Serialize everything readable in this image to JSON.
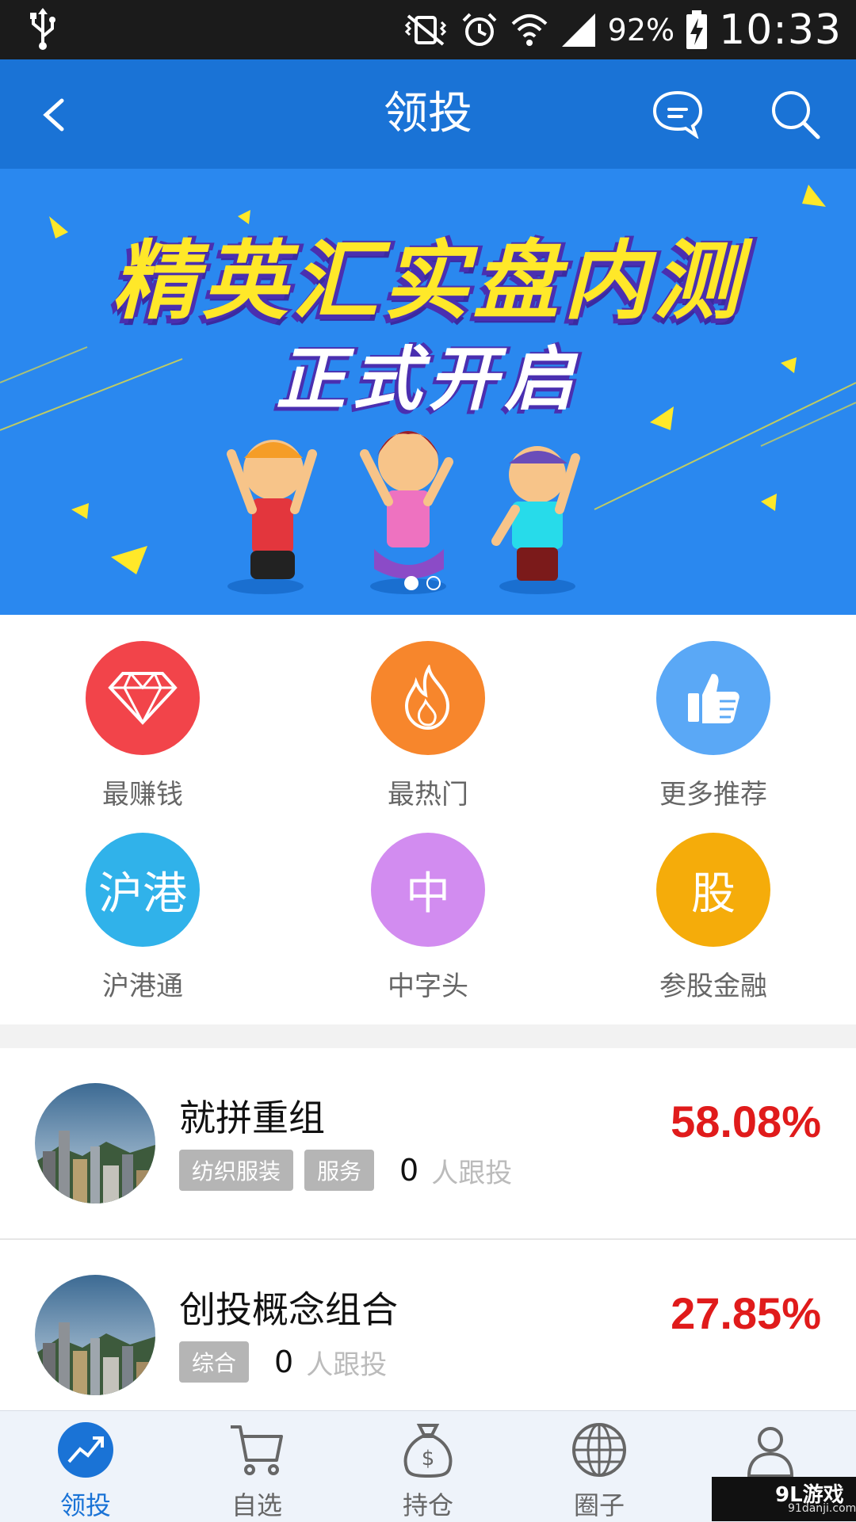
{
  "status_bar": {
    "battery": "92%",
    "time": "10:33"
  },
  "header": {
    "title": "领投"
  },
  "banner": {
    "headline": "精英汇实盘内测",
    "subline": "正式开启",
    "active_slide": 1,
    "total_slides": 2
  },
  "categories": [
    {
      "label": "最赚钱",
      "icon": "diamond-icon",
      "color": "#f2444a",
      "glyph": ""
    },
    {
      "label": "最热门",
      "icon": "flame-icon",
      "color": "#f7862c",
      "glyph": ""
    },
    {
      "label": "更多推荐",
      "icon": "thumbs-up-icon",
      "color": "#5aa8f6",
      "glyph": ""
    },
    {
      "label": "沪港通",
      "icon": "hk-connect-icon",
      "color": "#30b2ea",
      "glyph": "沪港"
    },
    {
      "label": "中字头",
      "icon": "zhong-icon",
      "color": "#d28cf0",
      "glyph": "中"
    },
    {
      "label": "参股金融",
      "icon": "gu-icon",
      "color": "#f5ac0a",
      "glyph": "股"
    }
  ],
  "portfolios": [
    {
      "name": "就拼重组",
      "tags": [
        "纺织服装",
        "服务"
      ],
      "followers": "0",
      "followers_label": "人跟投",
      "return": "58.08%"
    },
    {
      "name": "创投概念组合",
      "tags": [
        "综合"
      ],
      "followers": "0",
      "followers_label": "人跟投",
      "return": "27.85%"
    }
  ],
  "tabbar": {
    "items": [
      {
        "label": "领投",
        "icon": "trend-icon"
      },
      {
        "label": "自选",
        "icon": "cart-icon"
      },
      {
        "label": "持仓",
        "icon": "money-bag-icon"
      },
      {
        "label": "圈子",
        "icon": "globe-icon"
      },
      {
        "label": "",
        "icon": "profile-icon"
      }
    ],
    "active": 0
  },
  "watermark": {
    "brand": "9L游戏",
    "site": "91danji.com"
  }
}
